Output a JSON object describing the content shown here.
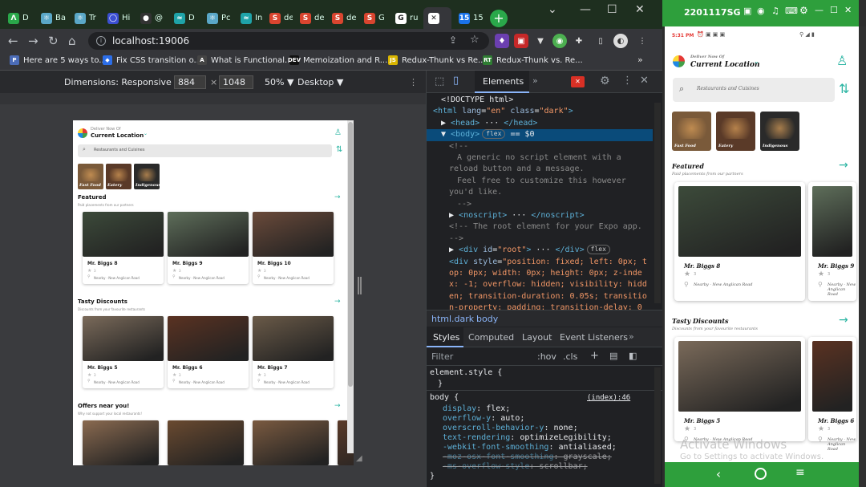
{
  "browser": {
    "tabs": [
      {
        "label": "D",
        "color": "#2aa84a",
        "glyph": "Λ"
      },
      {
        "label": "Ba",
        "color": "#5aa7c7",
        "glyph": "⚛"
      },
      {
        "label": "Tr",
        "color": "#5aa7c7",
        "glyph": "⚛"
      },
      {
        "label": "Hi",
        "color": "#3b4fd1",
        "glyph": "◯"
      },
      {
        "label": "@",
        "color": "#333333",
        "glyph": "●"
      },
      {
        "label": "D",
        "color": "#1fa3a8",
        "glyph": "≈"
      },
      {
        "label": "Pc",
        "color": "#5aa7c7",
        "glyph": "⚛"
      },
      {
        "label": "In",
        "color": "#1fa3a8",
        "glyph": "≈"
      },
      {
        "label": "de",
        "color": "#d9452f",
        "glyph": "S"
      },
      {
        "label": "de",
        "color": "#d9452f",
        "glyph": "S"
      },
      {
        "label": "de",
        "color": "#d9452f",
        "glyph": "S"
      },
      {
        "label": "G",
        "color": "#d9452f",
        "glyph": "S"
      },
      {
        "label": "ru",
        "color": "#ffffff",
        "glyph": "G"
      },
      {
        "label": "",
        "color": "#ffffff",
        "glyph": "✕"
      },
      {
        "label": "15",
        "color": "#1a73e8",
        "glyph": "15"
      }
    ],
    "url": "localhost:19006",
    "bookmarks": [
      {
        "label": "Here are 5 ways to...",
        "icon": "P",
        "color": "#4b6cb7"
      },
      {
        "label": "Fix CSS transition o...",
        "icon": "◆",
        "color": "#2c6ee8"
      },
      {
        "label": "What is Functional...",
        "icon": "A",
        "color": "#444444"
      },
      {
        "label": "Memoization and R...",
        "icon": "DEV",
        "color": "#111111"
      },
      {
        "label": "Redux-Thunk vs Re...",
        "icon": "JS",
        "color": "#d9b500"
      },
      {
        "label": "Redux-Thunk vs. Re...",
        "icon": "RT",
        "color": "#2e7d32"
      }
    ],
    "bookmarks_more": "»"
  },
  "device_toolbar": {
    "dimensions_label": "Dimensions: Responsive",
    "width": "884",
    "times": "×",
    "height": "1048",
    "zoom": "50%",
    "mode": "Desktop"
  },
  "app": {
    "deliver_now": "Deliver Now Of",
    "location": "Current Location",
    "search_placeholder": "Restaurants and Cuisines",
    "categories": [
      {
        "label": "Fast Food",
        "color": "#7a5a3a"
      },
      {
        "label": "Eatery",
        "color": "#5a3a28"
      },
      {
        "label": "Indigenous",
        "color": "#2a2a2a"
      }
    ],
    "sections": [
      {
        "title": "Featured",
        "subtitle": "Paid placements from our partners",
        "cards": [
          {
            "name": "Mr. Biggs 8",
            "rating": "3",
            "address": "Nearby · New Anglican Road",
            "color": "#3c4a3a"
          },
          {
            "name": "Mr. Biggs 9",
            "rating": "3",
            "address": "Nearby · New Anglican Road",
            "color": "#5e6e5a"
          },
          {
            "name": "Mr. Biggs 10",
            "rating": "3",
            "address": "Nearby · New Anglican Road",
            "color": "#6a4a3a"
          }
        ]
      },
      {
        "title": "Tasty Discounts",
        "subtitle": "Discounts from your favourite restaurants",
        "cards": [
          {
            "name": "Mr. Biggs 5",
            "rating": "3",
            "address": "Nearby · New Anglican Road",
            "color": "#7a6a5a"
          },
          {
            "name": "Mr. Biggs 6",
            "rating": "3",
            "address": "Nearby · New Anglican Road",
            "color": "#5a3222"
          },
          {
            "name": "Mr. Biggs 7",
            "rating": "3",
            "address": "Nearby · New Anglican Road",
            "color": "#6a5a48"
          }
        ]
      },
      {
        "title": "Offers near you!",
        "subtitle": "Why not support your local restaurants!",
        "cards": []
      }
    ]
  },
  "devtools": {
    "tabs": [
      "Elements"
    ],
    "more": "»",
    "code_lines": [
      {
        "indent": 1,
        "parts": [
          [
            "txt",
            "<!DOCTYPE html>"
          ]
        ]
      },
      {
        "indent": 0,
        "parts": [
          [
            "tag",
            "<html "
          ],
          [
            "attr",
            "lang"
          ],
          [
            "txt",
            "="
          ],
          [
            "val",
            "\"en\""
          ],
          [
            "attr",
            " class"
          ],
          [
            "txt",
            "="
          ],
          [
            "val",
            "\"dark\""
          ],
          [
            "tag",
            ">"
          ]
        ]
      },
      {
        "indent": 1,
        "parts": [
          [
            "txt",
            "▶ "
          ],
          [
            "tag",
            "<head>"
          ],
          [
            "txt",
            " ··· "
          ],
          [
            "tag",
            "</head>"
          ]
        ]
      },
      {
        "indent": 1,
        "parts": [
          [
            "txt",
            "▼ "
          ],
          [
            "tag",
            "<body>"
          ],
          [
            "badge",
            "flex"
          ],
          [
            "txt",
            " == $0"
          ]
        ],
        "selected": true
      },
      {
        "indent": 2,
        "parts": [
          [
            "cmt",
            "<!--"
          ]
        ]
      },
      {
        "indent": 3,
        "parts": [
          [
            "cmt",
            "  A generic no script element with a"
          ]
        ]
      },
      {
        "indent": 2,
        "parts": [
          [
            "cmt",
            "reload button and a message."
          ]
        ]
      },
      {
        "indent": 3,
        "parts": [
          [
            "cmt",
            "  Feel free to customize this however"
          ]
        ]
      },
      {
        "indent": 2,
        "parts": [
          [
            "cmt",
            "you'd like."
          ]
        ]
      },
      {
        "indent": 3,
        "parts": [
          [
            "cmt",
            "-->"
          ]
        ]
      },
      {
        "indent": 2,
        "parts": [
          [
            "txt",
            "▶ "
          ],
          [
            "tag",
            "<noscript>"
          ],
          [
            "txt",
            " ··· "
          ],
          [
            "tag",
            "</noscript>"
          ]
        ]
      },
      {
        "indent": 2,
        "parts": [
          [
            "cmt",
            "<!-- The root element for your Expo app."
          ]
        ]
      },
      {
        "indent": 2,
        "parts": [
          [
            "cmt",
            "-->"
          ]
        ]
      },
      {
        "indent": 2,
        "parts": [
          [
            "txt",
            "▶ "
          ],
          [
            "tag",
            "<div "
          ],
          [
            "attr",
            "id"
          ],
          [
            "txt",
            "="
          ],
          [
            "val",
            "\"root\""
          ],
          [
            "tag",
            ">"
          ],
          [
            "txt",
            " ··· "
          ],
          [
            "tag",
            "</div>"
          ],
          [
            "badge",
            "flex"
          ]
        ]
      },
      {
        "indent": 2,
        "parts": [
          [
            "tag",
            "<div "
          ],
          [
            "attr",
            "style"
          ],
          [
            "txt",
            "="
          ],
          [
            "val",
            "\"position: fixed; left: 0px; t"
          ]
        ]
      },
      {
        "indent": 2,
        "parts": [
          [
            "val",
            "op: 0px; width: 0px; height: 0px; z-inde"
          ]
        ]
      },
      {
        "indent": 2,
        "parts": [
          [
            "val",
            "x: -1; overflow: hidden; visibility: hidd"
          ]
        ]
      },
      {
        "indent": 2,
        "parts": [
          [
            "val",
            "en; transition-duration: 0.05s; transitio"
          ]
        ]
      },
      {
        "indent": 2,
        "parts": [
          [
            "val",
            "n-property: padding; transition-delay: 0"
          ]
        ]
      }
    ],
    "breadcrumbs": [
      "html.dark",
      "body"
    ],
    "panel_tabs": [
      "Styles",
      "Computed",
      "Layout",
      "Event Listeners"
    ],
    "filter_placeholder": "Filter",
    "filter_hov": ":hov",
    "filter_cls": ".cls",
    "element_style": "element.style {",
    "close_brace": "}",
    "body_rule": "body {",
    "source": "(index):46",
    "declarations": [
      {
        "prop": "display",
        "value": "flex;",
        "struck": false
      },
      {
        "prop": "overflow-y",
        "value": "auto;",
        "struck": false
      },
      {
        "prop": "overscroll-behavior-y",
        "value": "none;",
        "struck": false
      },
      {
        "prop": "text-rendering",
        "value": "optimizeLegibility;",
        "struck": false
      },
      {
        "prop": "-webkit-font-smoothing",
        "value": "antialiased;",
        "struck": false
      },
      {
        "prop": "-moz-osx-font-smoothing",
        "value": "grayscale;",
        "struck": true
      },
      {
        "prop": "-ms-overflow-style",
        "value": "scrollbar;",
        "struck": true
      }
    ]
  },
  "phone": {
    "device_name": "2201117SG",
    "status_time": "5:31 PM",
    "watermark_title": "Activate Windows",
    "watermark_sub": "Go to Settings to activate Windows."
  },
  "colors": {
    "accent": "#2bb5a3",
    "android_green": "#2e9f3c"
  }
}
